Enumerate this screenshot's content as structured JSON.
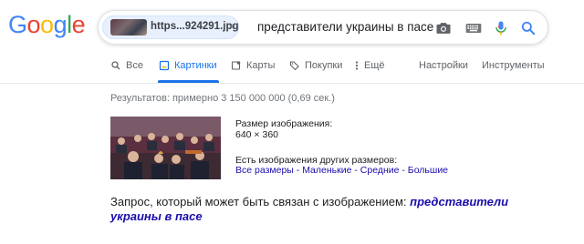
{
  "logo": {
    "letters": [
      "G",
      "o",
      "o",
      "g",
      "l",
      "e"
    ],
    "colors": [
      "#4285F4",
      "#EA4335",
      "#FBBC05",
      "#4285F4",
      "#34A853",
      "#EA4335"
    ]
  },
  "search": {
    "image_chip_label": "https...924291.jpg",
    "image_chip_close": "×",
    "query": "представители украины в пасе",
    "icons": [
      "camera-icon",
      "keyboard-icon",
      "microphone-icon",
      "search-icon"
    ]
  },
  "tabs": [
    {
      "label": "Все",
      "icon": "search-icon"
    },
    {
      "label": "Картинки",
      "icon": "image-icon",
      "active": true
    },
    {
      "label": "Карты",
      "icon": "map-icon"
    },
    {
      "label": "Покупки",
      "icon": "tag-icon"
    },
    {
      "label": "Ещё",
      "icon": "more-vert-icon"
    }
  ],
  "tools": {
    "settings_label": "Настройки",
    "tools_label": "Инструменты"
  },
  "results": {
    "count_text": "Результатов: примерно 3 150 000 000 (0,69 сек.)",
    "image_size_label": "Размер изображения:",
    "image_size_value": "640 × 360",
    "other_sizes_label": "Есть изображения других размеров:",
    "size_links": [
      "Все размеры",
      "Маленькие",
      "Средние",
      "Большие"
    ],
    "size_separator": " - "
  },
  "related": {
    "prefix": "Запрос, который может быть связан с изображением:",
    "query_link": "представители украины в пасе"
  },
  "colors": {
    "accent": "#1a73e8",
    "link": "#1a0dab",
    "muted": "#70757a"
  }
}
